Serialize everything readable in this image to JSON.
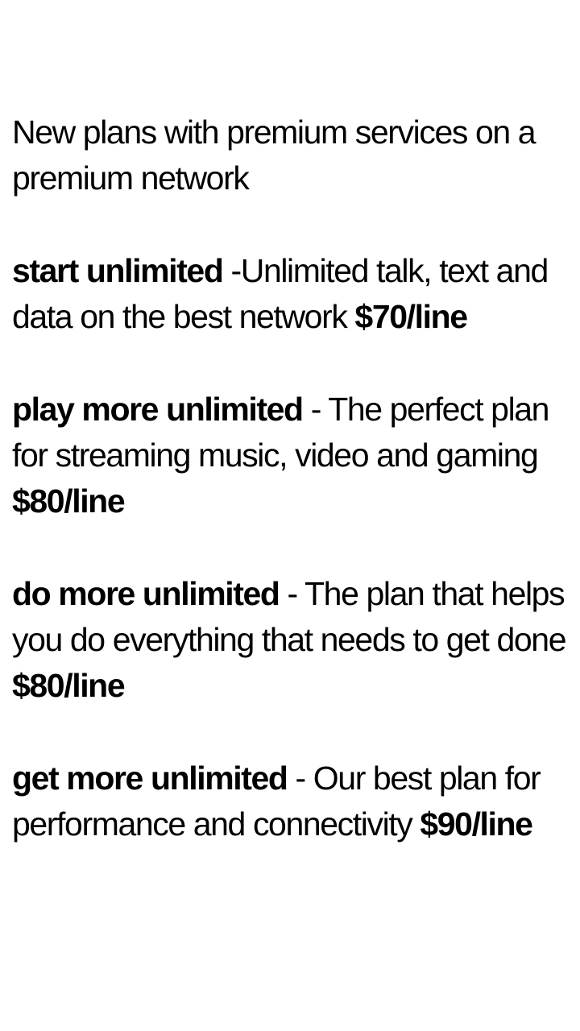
{
  "intro": "New plans with premium services on a premium network",
  "plans": [
    {
      "name": "start unlimited",
      "description": " -Unlimited talk, text and data on the best network ",
      "price": "$70/line"
    },
    {
      "name": "play more unlimited",
      "description": " - The perfect plan for streaming music, video and gaming ",
      "price": "$80/line"
    },
    {
      "name": "do more unlimited",
      "description": " - The plan that helps you do everything that needs to get done ",
      "price": "$80/line"
    },
    {
      "name": "get more unlimited",
      "description": " - Our best plan for performance and connectivity ",
      "price": "$90/line"
    }
  ]
}
